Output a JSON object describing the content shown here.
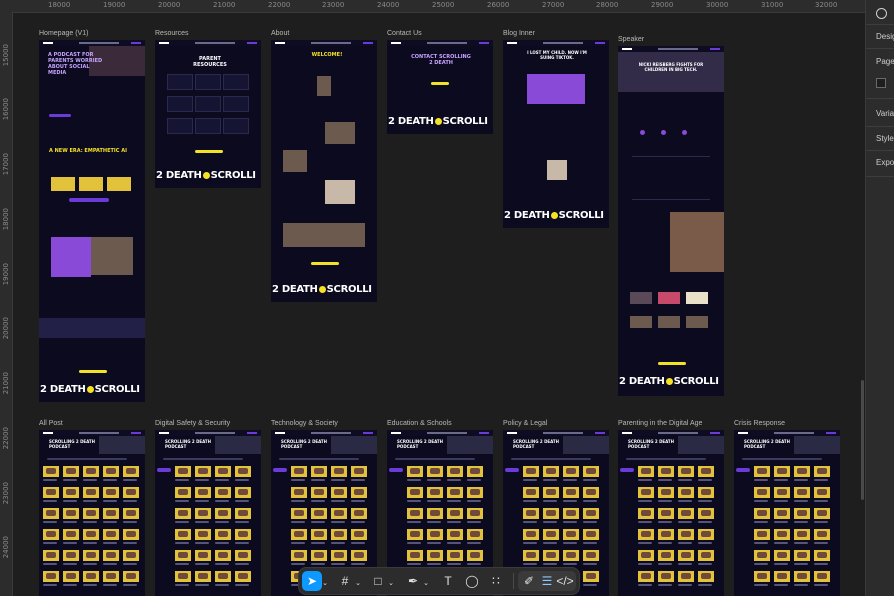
{
  "ruler": {
    "x_labels": [
      "18000",
      "19000",
      "20000",
      "21000",
      "22000",
      "23000",
      "24000",
      "25000",
      "26000",
      "27000",
      "28000",
      "29000",
      "30000",
      "31000",
      "32000"
    ],
    "y_labels": [
      "15000",
      "16000",
      "17000",
      "18000",
      "19000",
      "20000",
      "21000",
      "22000",
      "23000",
      "24000"
    ]
  },
  "panel": {
    "tabs": [
      "Desig",
      "Page",
      "Varia",
      "Style",
      "Expo"
    ]
  },
  "frames": [
    {
      "label": "Homepage (V1)"
    },
    {
      "label": "Resources"
    },
    {
      "label": "About"
    },
    {
      "label": "Contact Us"
    },
    {
      "label": "Blog Inner"
    },
    {
      "label": "Speaker"
    },
    {
      "label": "All Post"
    },
    {
      "label": "Digital Safety & Security"
    },
    {
      "label": "Technology & Society"
    },
    {
      "label": "Education & Schools"
    },
    {
      "label": "Policy & Legal"
    },
    {
      "label": "Parenting in the Digital Age"
    },
    {
      "label": "Crisis Response"
    }
  ],
  "content": {
    "footer_left": "2 DEATH",
    "footer_right": "SCROLLI",
    "home_hero": "A PODCAST FOR PARENTS WORRIED ABOUT SOCIAL MEDIA",
    "home_era": "A NEW ERA: EMPATHETIC AI",
    "resources_hero": "PARENT RESOURCES",
    "about_hero": "WELCOME!",
    "contact_hero": "CONTACT SCROLLING 2 DEATH",
    "blog_hero": "I LOST MY CHILD. NOW I'M SUING TIKTOK.",
    "speaker_hero": "NICKI REISBERG FIGHTS FOR CHILDREN IN BIG TECH.",
    "podcast_hero": "SCROLLING 2 DEATH PODCAST"
  },
  "toolbar": {
    "tools": [
      "move",
      "frame",
      "shape",
      "pen",
      "text",
      "comment",
      "actions",
      "draw",
      "dev-mode"
    ]
  },
  "colors": {
    "canvas": "#1e1e1e",
    "frame_bg": "#0b0a1f",
    "accent_purple": "#6b3bd8",
    "accent_yellow": "#f4e226",
    "figma_blue": "#0d99ff"
  }
}
